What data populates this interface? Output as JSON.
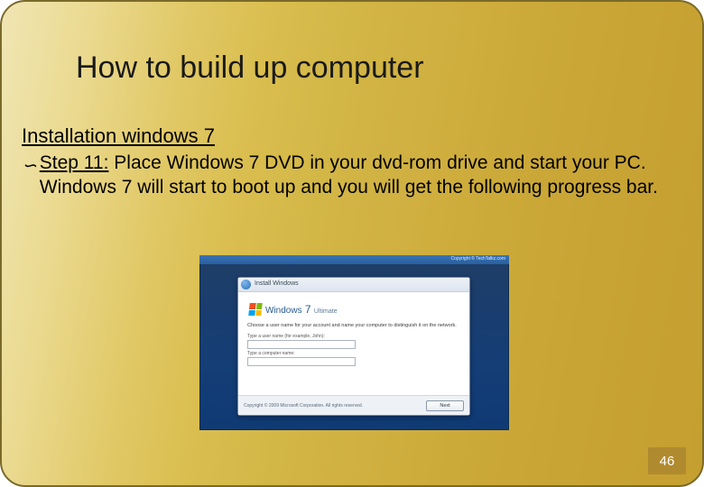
{
  "slide": {
    "title": "How to build up computer",
    "subtitle": "Installation windows 7",
    "bullet_glyph": "∽",
    "step_label": "Step 11:",
    "step_text": " Place Windows 7 DVD in your dvd-rom drive and start your PC. Windows 7 will start to boot up and you will get the following progress bar.",
    "page_number": "46"
  },
  "installer": {
    "overlay_credit": "Copyright © TechTalkz.com",
    "window_title": "Install Windows",
    "brand_word": "Windows",
    "brand_num": " 7 ",
    "brand_edition": "Ultimate",
    "lead_text": "Choose a user name for your account and name your computer to distinguish it on the network.",
    "field1_label": "Type a user name (for example, John):",
    "field2_label": "Type a computer name:",
    "help_link": "",
    "copyright": "Copyright © 2009 Microsoft Corporation. All rights reserved.",
    "next_button": "Next"
  }
}
